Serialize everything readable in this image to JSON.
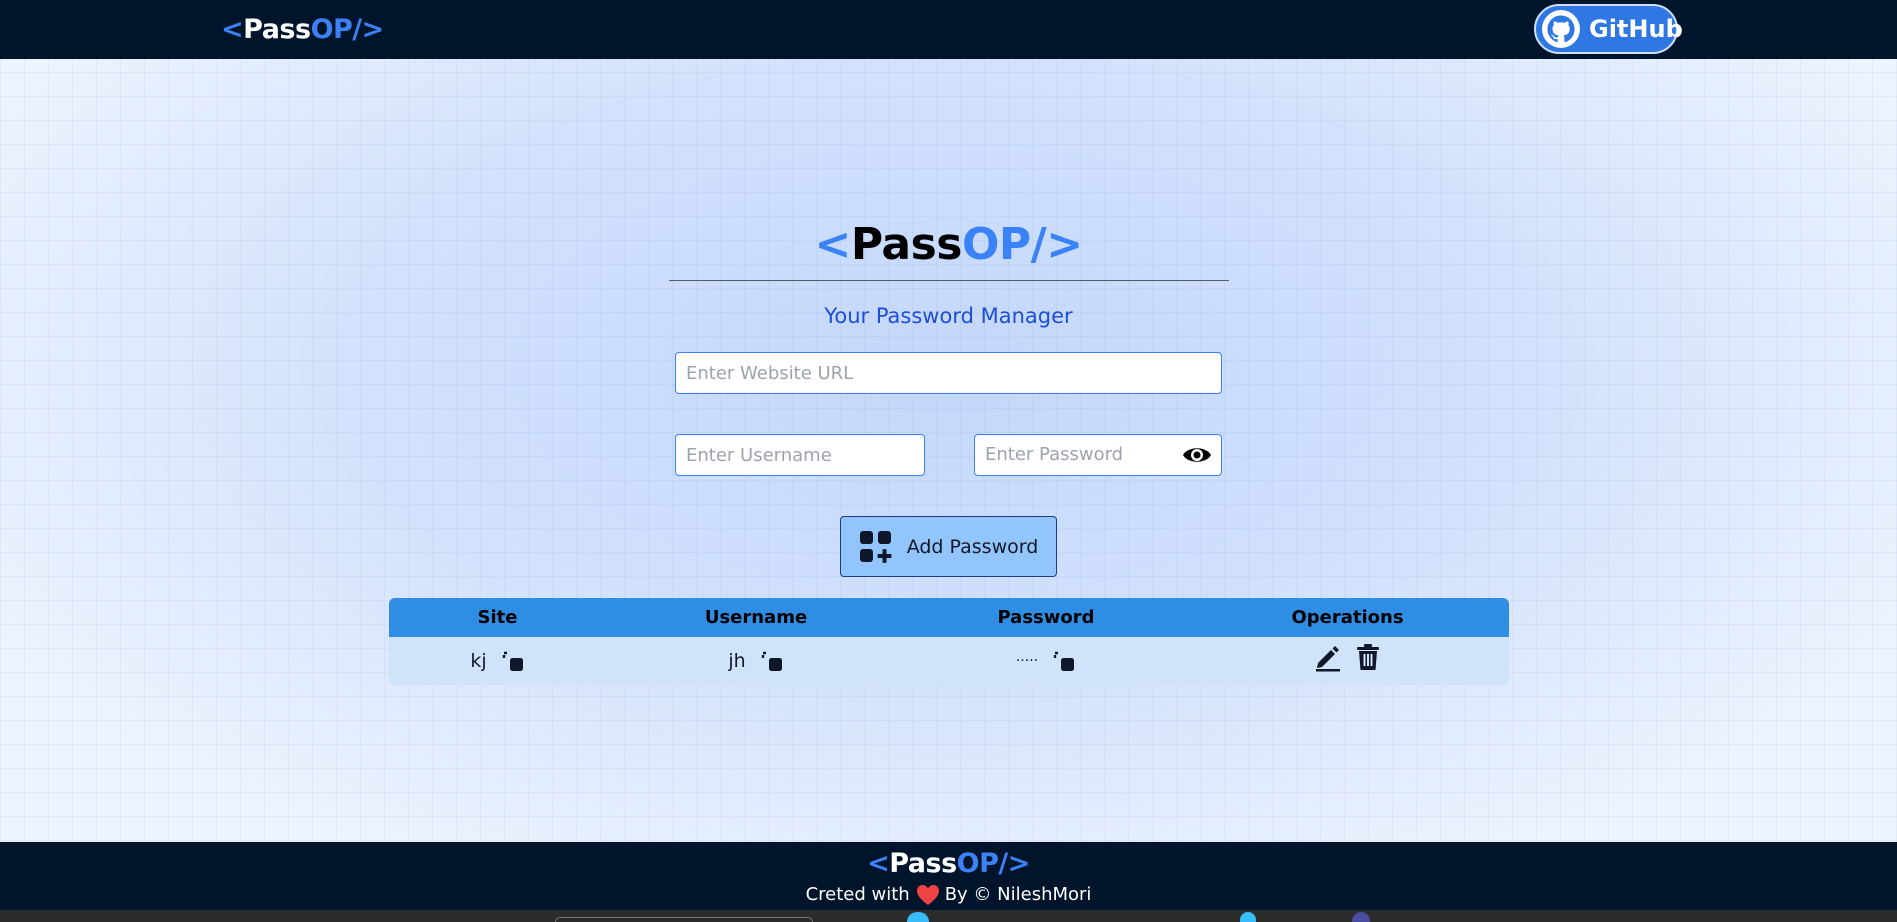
{
  "app": {
    "logo": {
      "open": "<",
      "pass": "Pass",
      "op": "OP/",
      "close": ">"
    }
  },
  "nav": {
    "github_label": "GitHub"
  },
  "hero": {
    "subtitle": "Your Password Manager"
  },
  "form": {
    "site_placeholder": "Enter Website URL",
    "username_placeholder": "Enter Username",
    "password_placeholder": "Enter Password",
    "add_button_label": "Add Password"
  },
  "table": {
    "headers": [
      "Site",
      "Username",
      "Password",
      "Operations"
    ],
    "rows": [
      {
        "site": "kj",
        "username": "jh",
        "password": "·····"
      }
    ]
  },
  "footer": {
    "credit_prefix": "Creted with",
    "credit_suffix": "By © NileshMori"
  },
  "colors": {
    "nav_bg": "#00142b",
    "accent": "#3b82f6",
    "table_header": "#2f8de4",
    "table_row": "#cfe3fb",
    "button_bg": "#93c5fd",
    "heart": "#ef4444"
  },
  "icons": {
    "github": "github-icon",
    "eye": "eye-icon",
    "add": "add-grid-icon",
    "copy": "copy-icon",
    "edit": "edit-icon",
    "delete": "trash-icon",
    "heart": "heart-icon"
  }
}
